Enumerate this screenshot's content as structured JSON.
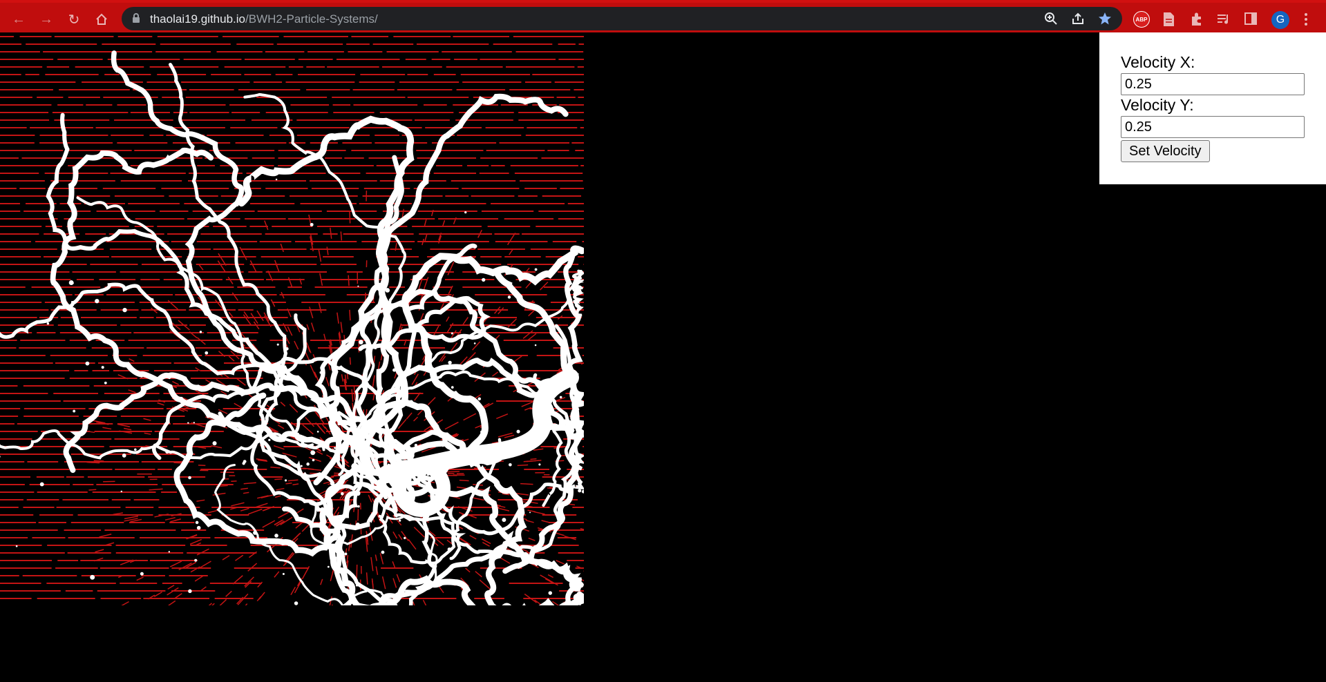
{
  "browser": {
    "url_host": "thaolai19.github.io",
    "url_path": "/BWH2-Particle-Systems/",
    "profile_initial": "G",
    "extension_abp_label": "ABP",
    "icons": [
      "back-icon",
      "forward-icon",
      "reload-icon",
      "home-icon",
      "lock-icon",
      "zoom-icon",
      "share-icon",
      "star-icon",
      "abp-icon",
      "document-icon",
      "extensions-icon",
      "media-icon",
      "side-panel-icon",
      "profile-avatar",
      "menu-icon"
    ]
  },
  "panel": {
    "velocity_x_label": "Velocity X:",
    "velocity_x_value": "0.25",
    "velocity_y_label": "Velocity Y:",
    "velocity_y_value": "0.25",
    "set_button_label": "Set Velocity"
  },
  "colors": {
    "chrome": "#c00d0d",
    "field_line": "#c41414",
    "particle": "#ffffff",
    "background": "#000000"
  }
}
